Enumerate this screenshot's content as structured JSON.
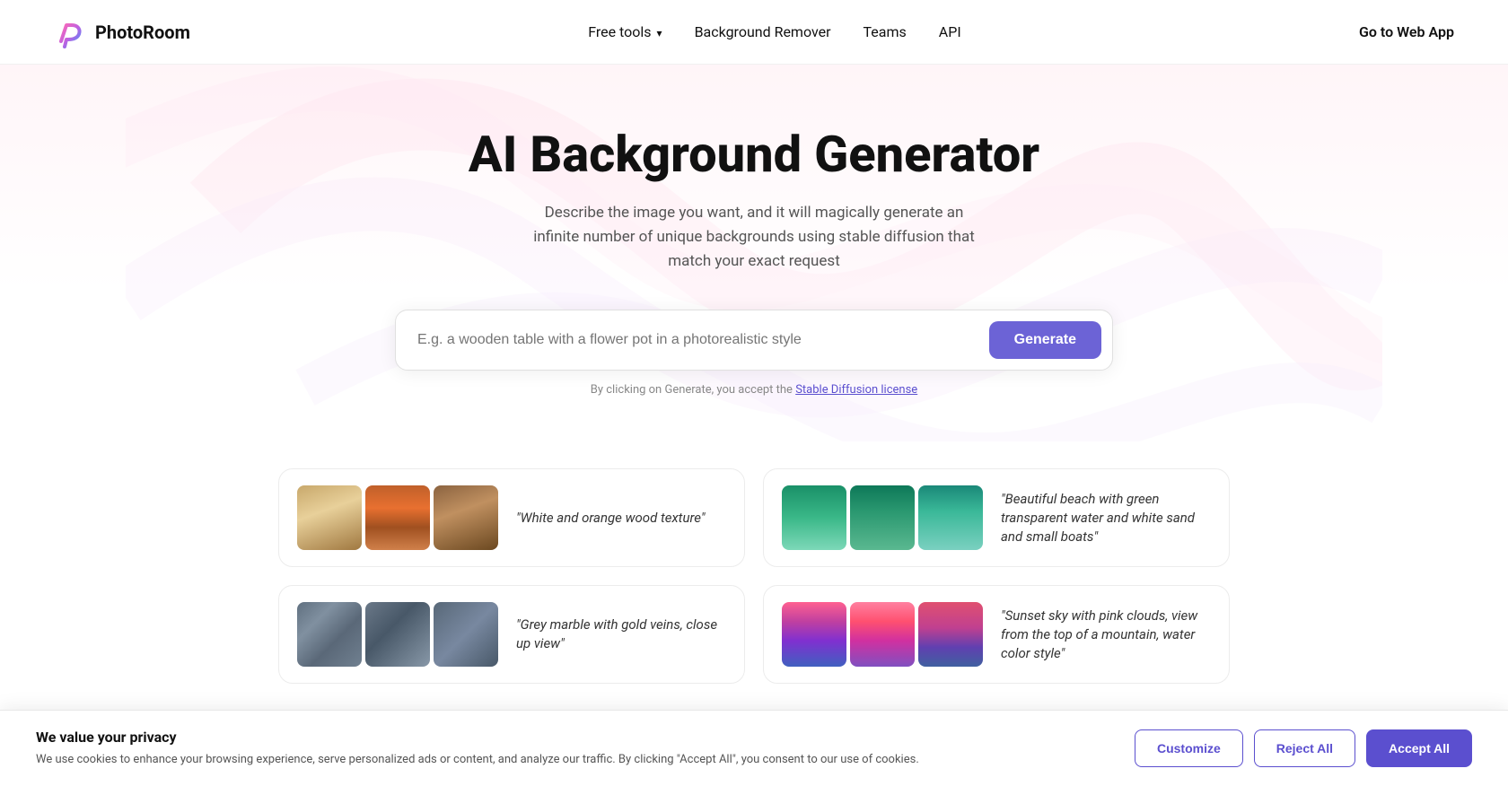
{
  "nav": {
    "logo_text": "PhotoRoom",
    "links": [
      {
        "id": "free-tools",
        "label": "Free tools",
        "has_dropdown": true
      },
      {
        "id": "background-remover",
        "label": "Background Remover",
        "has_dropdown": false
      },
      {
        "id": "teams",
        "label": "Teams",
        "has_dropdown": false
      },
      {
        "id": "api",
        "label": "API",
        "has_dropdown": false
      }
    ],
    "cta_label": "Go to Web App"
  },
  "hero": {
    "title": "AI Background Generator",
    "subtitle": "Describe the image you want, and it will magically generate an infinite number of unique backgrounds using stable diffusion that match your exact request",
    "input_placeholder": "E.g. a wooden table with a flower pot in a photorealistic style",
    "generate_label": "Generate",
    "disclaimer_text": "By clicking on Generate, you accept the ",
    "disclaimer_link_label": "Stable Diffusion license"
  },
  "examples": [
    {
      "id": "wood",
      "text": "\"White and orange wood texture\"",
      "images": [
        "wood-1",
        "wood-2",
        "wood-3"
      ]
    },
    {
      "id": "beach",
      "text": "\"Beautiful beach with green transparent water and white sand and small boats\"",
      "images": [
        "beach-1",
        "beach-2",
        "beach-3"
      ]
    },
    {
      "id": "marble",
      "text": "\"Grey marble with gold veins, close up view\"",
      "images": [
        "marble-1",
        "marble-2",
        "marble-3"
      ]
    },
    {
      "id": "sunset",
      "text": "\"Sunset sky with pink clouds, view from the top of a mountain, water color style\"",
      "images": [
        "sunset-1",
        "sunset-2",
        "sunset-3"
      ]
    }
  ],
  "cookie": {
    "title": "We value your privacy",
    "description": "We use cookies to enhance your browsing experience, serve personalized ads or content, and analyze our traffic. By clicking \"Accept All\", you consent to our use of cookies.",
    "customize_label": "Customize",
    "reject_label": "Reject All",
    "accept_label": "Accept All"
  }
}
